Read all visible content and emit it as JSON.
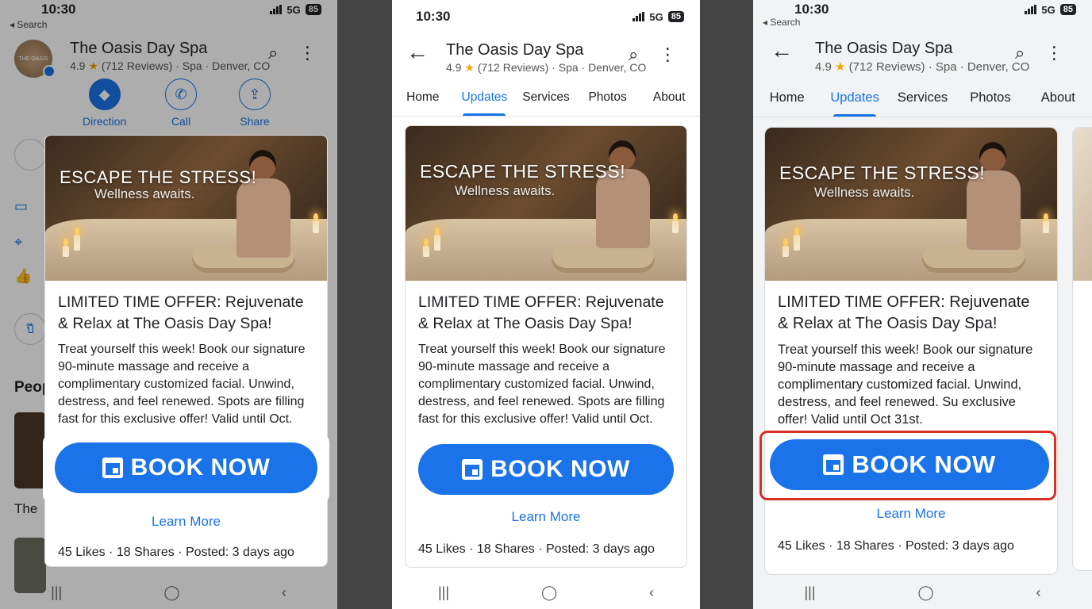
{
  "status": {
    "time": "10:30",
    "network": "5G",
    "battery": "85",
    "back_app": "◂ Search"
  },
  "business": {
    "name": "The Oasis Day Spa",
    "rating": "4.9",
    "reviews": "(712 Reviews)",
    "category": "Spa",
    "location": "Denver, CO",
    "logo_text": "THE OASIS"
  },
  "actions": [
    {
      "label": "Direction"
    },
    {
      "label": "Call"
    },
    {
      "label": "Share"
    }
  ],
  "panel1_partial": {
    "people_heading": "Peop",
    "the_label": "The",
    "chip_text": "ปี"
  },
  "tabs": [
    "Home",
    "Updates",
    "Services",
    "Photos",
    "About"
  ],
  "active_tab": "Updates",
  "post": {
    "hero_title": "ESCAPE THE STRESS!",
    "hero_subtitle": "Wellness awaits.",
    "title": "LIMITED TIME OFFER: Rejuvenate & Relax at The Oasis Day Spa!",
    "body": "Treat yourself this week! Book our signature 90-minute massage and receive a complimentary customized facial. Unwind, destress, and feel renewed. Spots are filling fast for this exclusive offer! Valid until Oct.",
    "body_variant": "Treat yourself this week! Book our signature 90-minute massage and receive a complimentary customized facial. Unwind, destress, and feel renewed. Su exclusive offer! Valid until Oct 31st.",
    "cta": "BOOK NOW",
    "learn_more": "Learn More",
    "stats": "45 Likes · 18 Shares · Posted: 3 days ago"
  },
  "nav": {
    "recents": "|||",
    "home": "◯",
    "back": "‹"
  },
  "colors": {
    "accent": "#1a73e8",
    "highlight": "#d93025",
    "star": "#f2a600"
  }
}
